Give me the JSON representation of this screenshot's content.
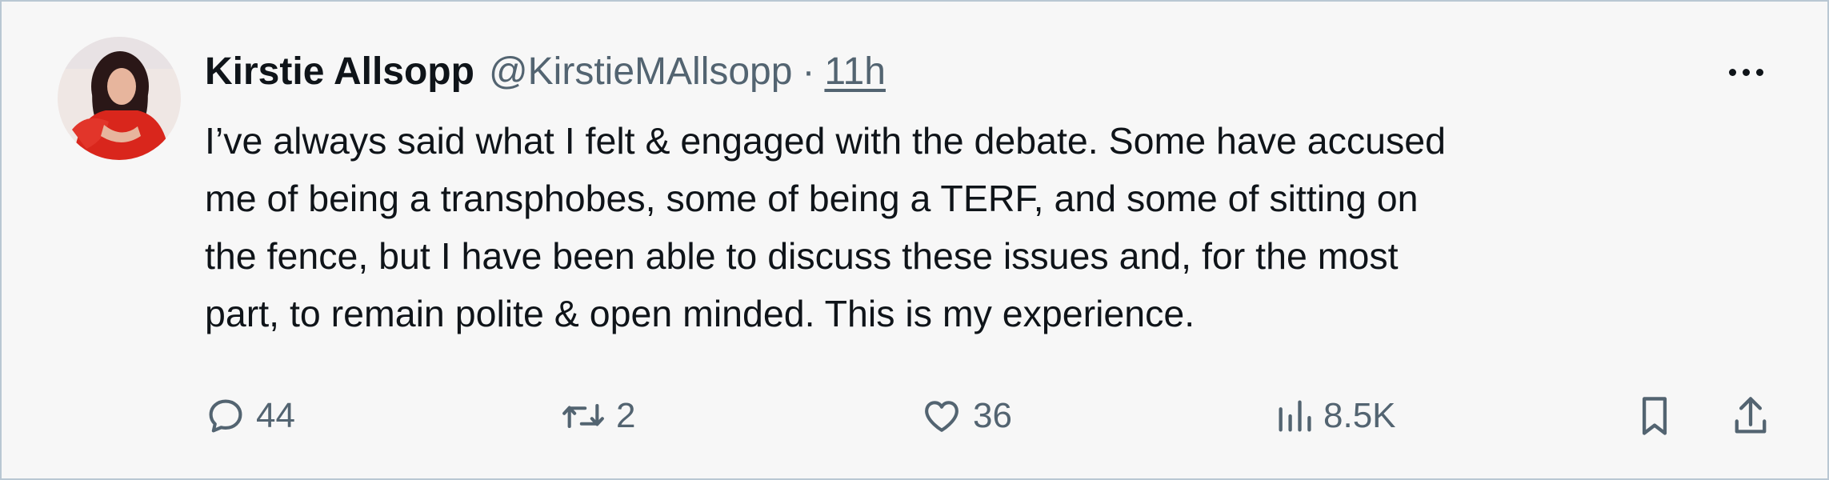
{
  "tweet": {
    "author_name": "Kirstie Allsopp",
    "handle": "@KirstieMAllsopp",
    "separator": "·",
    "time": "11h",
    "text_lines": [
      "I’ve always said what I felt & engaged with the debate. Some have accused",
      "me of being a transphobes, some of being a TERF, and some of sitting on",
      "the fence, but I have been able to discuss these issues and, for the most",
      "part, to remain polite & open minded. This is my experience."
    ],
    "more_icon": "more-dots-icon",
    "avatar_icon": "avatar"
  },
  "actions": {
    "reply": {
      "icon": "reply-icon",
      "count": "44"
    },
    "retweet": {
      "icon": "retweet-icon",
      "count": "2"
    },
    "like": {
      "icon": "heart-icon",
      "count": "36"
    },
    "views": {
      "icon": "views-icon",
      "count": "8.5K"
    },
    "bookmark": {
      "icon": "bookmark-icon"
    },
    "share": {
      "icon": "share-icon"
    }
  },
  "colors": {
    "background": "#f7f7f7",
    "text": "#0f1419",
    "muted": "#536471",
    "border": "#b9c7d3",
    "avatar_red": "#d9261c"
  }
}
